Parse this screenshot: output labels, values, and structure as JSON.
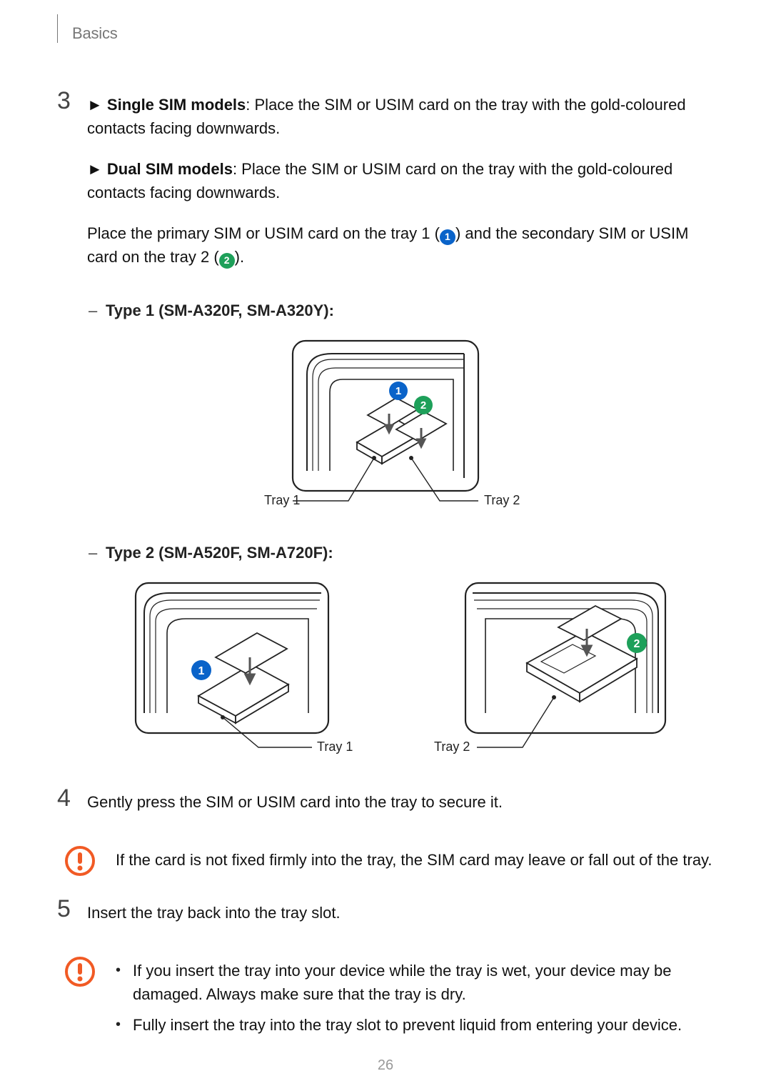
{
  "header": {
    "section": "Basics"
  },
  "step3": {
    "num": "3",
    "single_bold": "Single SIM models",
    "single_text": ": Place the SIM or USIM card on the tray with the gold-coloured contacts facing downwards.",
    "dual_bold": "Dual SIM models",
    "dual_text": ": Place the SIM or USIM card on the tray with the gold-coloured contacts facing downwards.",
    "placement_pre": "Place the primary SIM or USIM card on the tray 1 (",
    "placement_mid": ") and the secondary SIM or USIM card on the tray 2 (",
    "placement_post": ").",
    "type1_label": "Type 1 (SM-A320F, SM-A320Y):",
    "type2_label": "Type 2 (SM-A520F, SM-A720F):"
  },
  "fig1": {
    "tray1": "Tray 1",
    "tray2": "Tray 2",
    "badge1": "1",
    "badge2": "2"
  },
  "fig2": {
    "tray1": "Tray 1",
    "tray2": "Tray 2",
    "badge1": "1",
    "badge2": "2"
  },
  "step4": {
    "num": "4",
    "text": "Gently press the SIM or USIM card into the tray to secure it."
  },
  "caution1": {
    "text": "If the card is not fixed firmly into the tray, the SIM card may leave or fall out of the tray."
  },
  "step5": {
    "num": "5",
    "text": "Insert the tray back into the tray slot."
  },
  "caution2": {
    "b1": "If you insert the tray into your device while the tray is wet, your device may be damaged. Always make sure that the tray is dry.",
    "b2": "Fully insert the tray into the tray slot to prevent liquid from entering your device."
  },
  "page_number": "26"
}
